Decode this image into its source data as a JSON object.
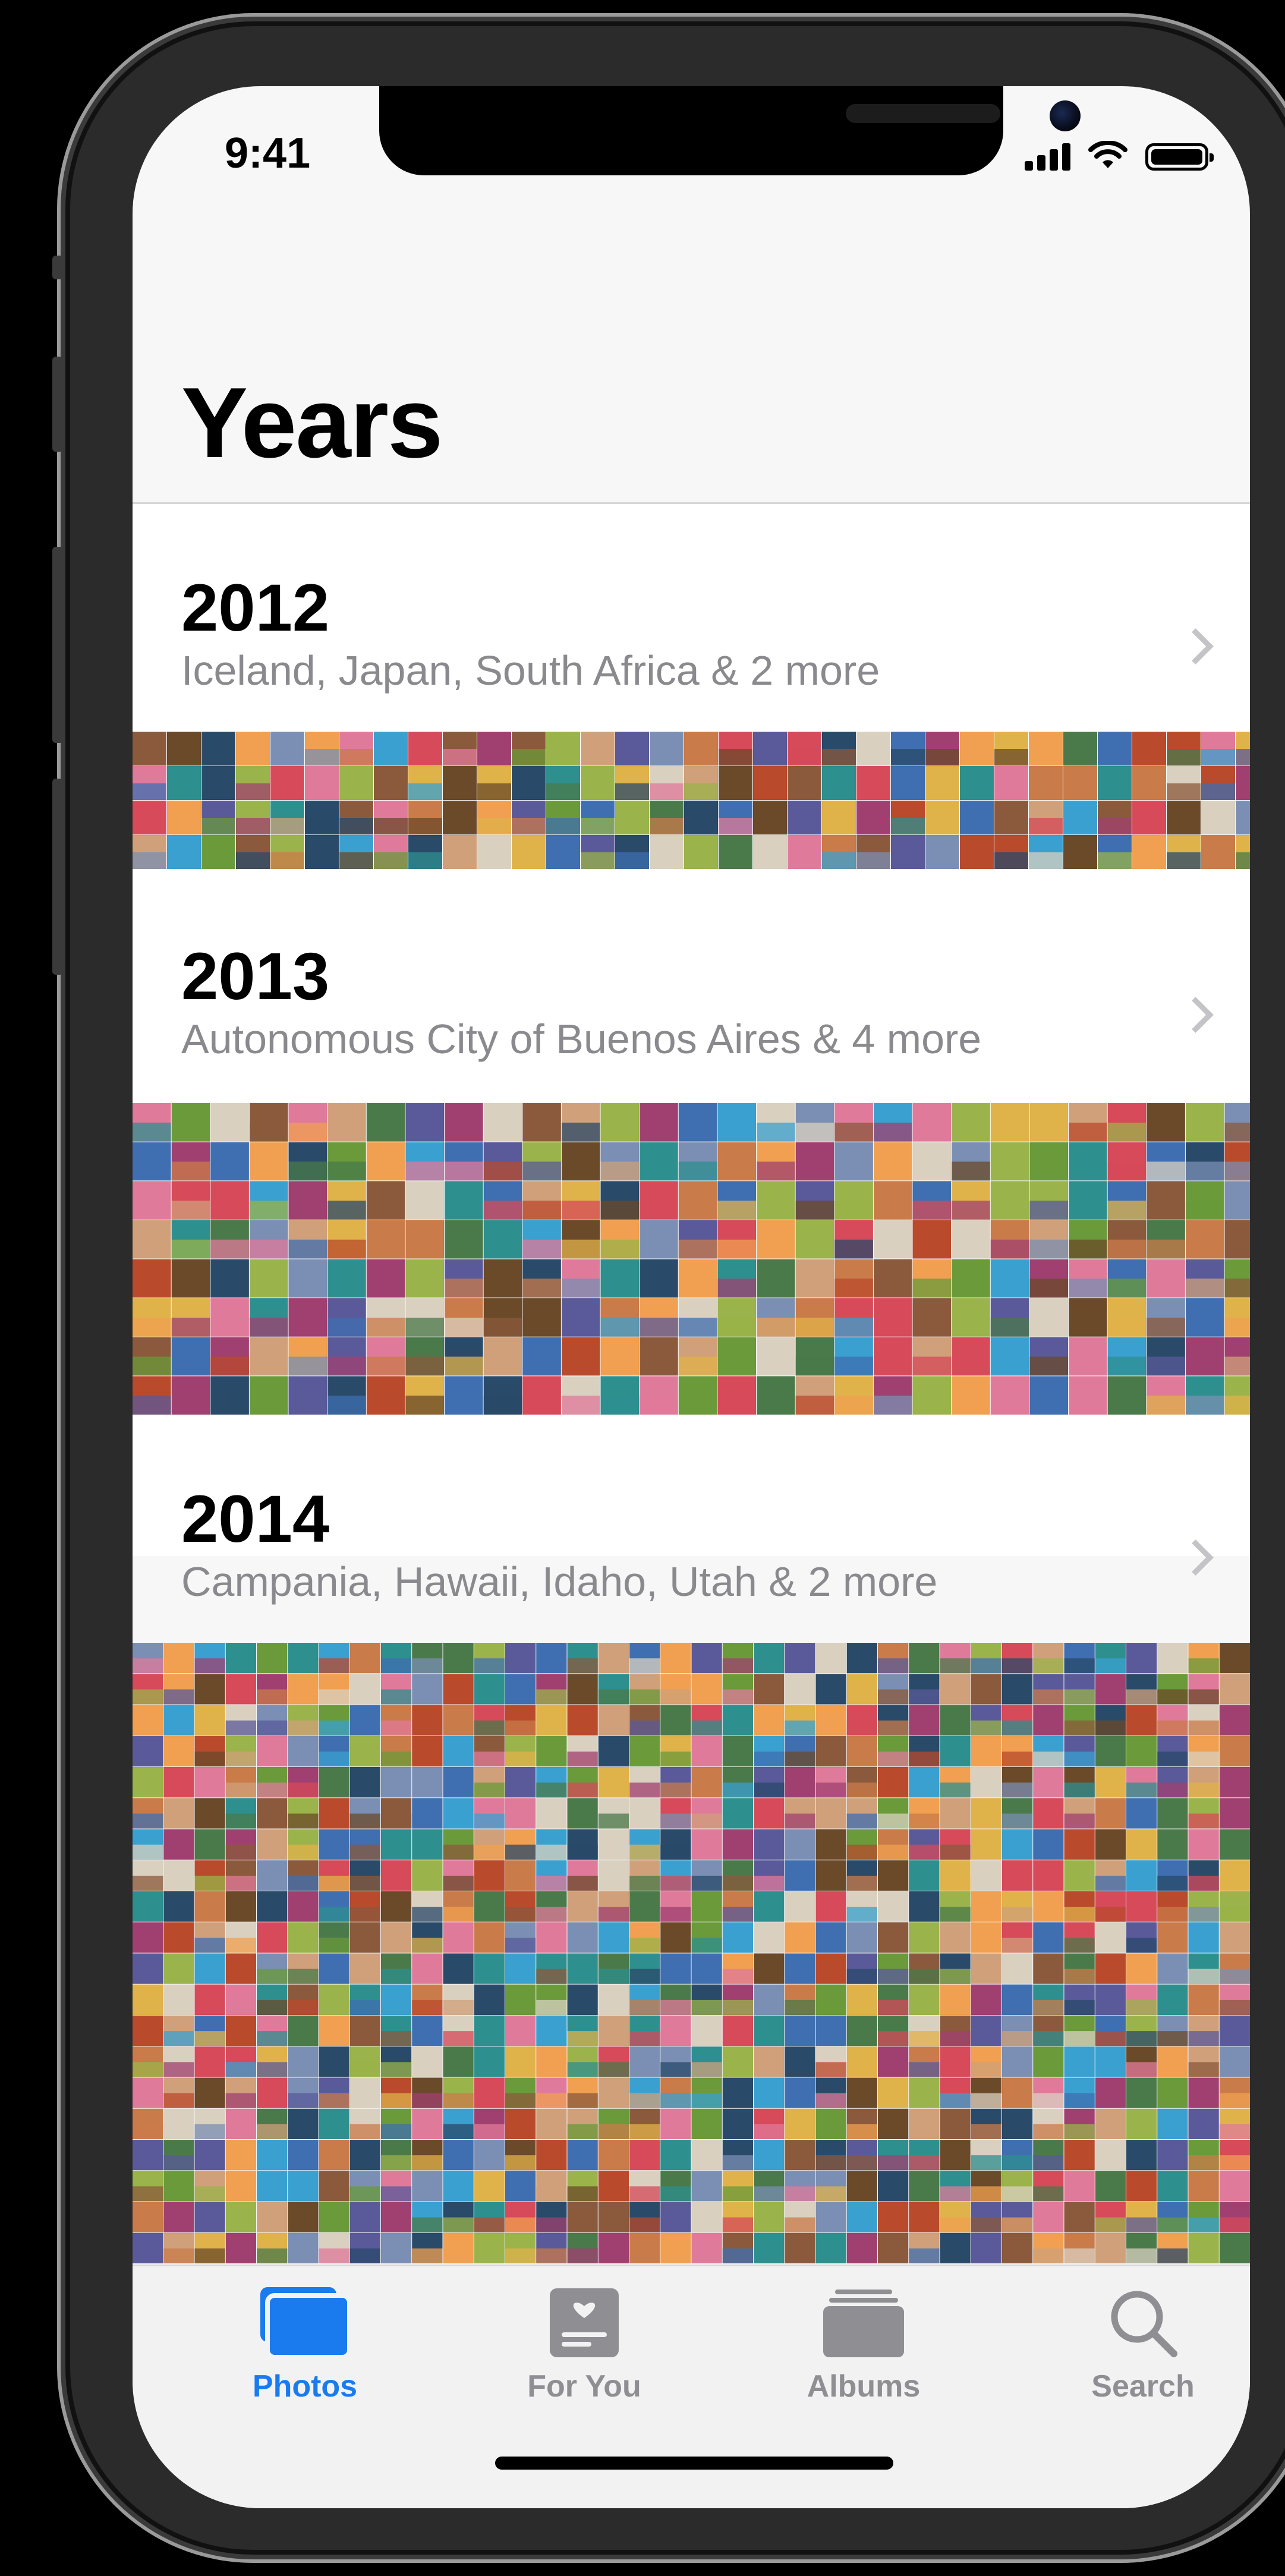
{
  "status_bar": {
    "time": "9:41"
  },
  "header": {
    "title": "Years"
  },
  "years": [
    {
      "year": "2012",
      "places": "Iceland, Japan, South Africa & 2 more"
    },
    {
      "year": "2013",
      "places": "Autonomous City of Buenos Aires & 4 more"
    },
    {
      "year": "2014",
      "places": "Campania, Hawaii, Idaho, Utah & 2 more"
    }
  ],
  "tab_bar": {
    "photos": "Photos",
    "for_you": "For You",
    "albums": "Albums",
    "search": "Search"
  },
  "colors": {
    "accent": "#1a7bef",
    "inactive": "#8e8e93",
    "subtitle": "#8a8a8e"
  },
  "icons": {
    "status": [
      "cellular-signal-icon",
      "wifi-icon",
      "battery-icon"
    ],
    "tabs": [
      "photos-icon",
      "for-you-icon",
      "albums-icon",
      "search-icon"
    ]
  }
}
